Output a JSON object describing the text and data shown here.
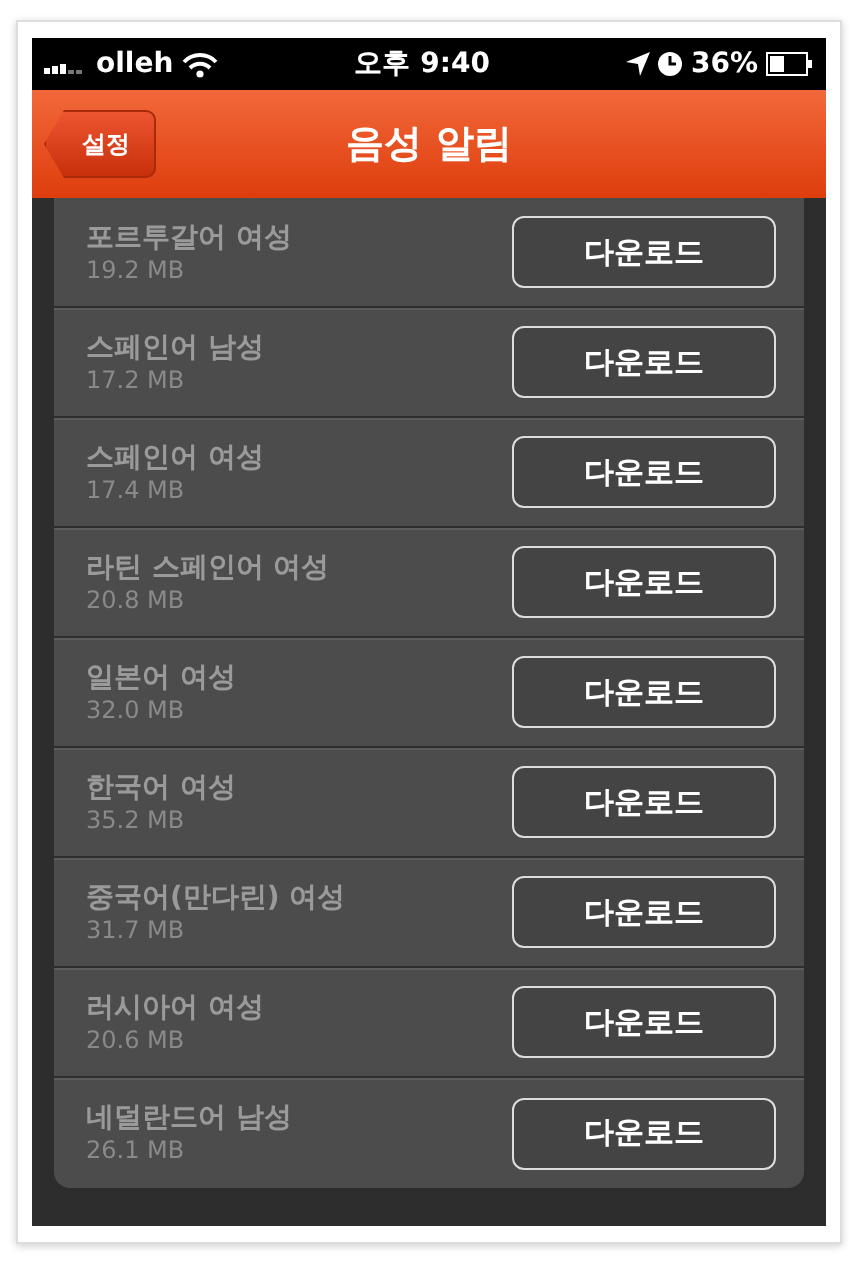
{
  "status_bar": {
    "carrier": "olleh",
    "time": "오후 9:40",
    "battery": "36%"
  },
  "nav": {
    "back": "설정",
    "title": "음성 알림"
  },
  "voices": [
    {
      "name": "포르투갈어 여성",
      "size": "19.2 MB",
      "action": "다운로드"
    },
    {
      "name": "스페인어 남성",
      "size": "17.2 MB",
      "action": "다운로드"
    },
    {
      "name": "스페인어 여성",
      "size": "17.4 MB",
      "action": "다운로드"
    },
    {
      "name": "라틴 스페인어 여성",
      "size": "20.8 MB",
      "action": "다운로드"
    },
    {
      "name": "일본어 여성",
      "size": "32.0 MB",
      "action": "다운로드"
    },
    {
      "name": "한국어 여성",
      "size": "35.2 MB",
      "action": "다운로드"
    },
    {
      "name": "중국어(만다린) 여성",
      "size": "31.7 MB",
      "action": "다운로드"
    },
    {
      "name": "러시아어 여성",
      "size": "20.6 MB",
      "action": "다운로드"
    },
    {
      "name": "네덜란드어 남성",
      "size": "26.1 MB",
      "action": "다운로드"
    }
  ]
}
